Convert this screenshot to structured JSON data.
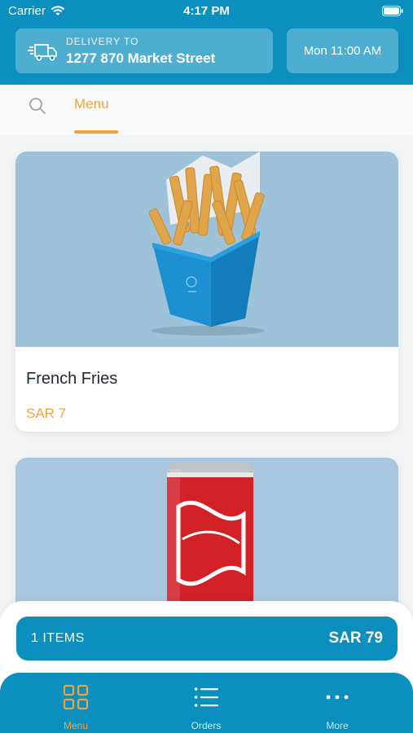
{
  "status_bar": {
    "carrier": "Carrier",
    "time": "4:17 PM"
  },
  "header": {
    "delivery_label": "DELIVERY TO",
    "delivery_address": "1277 870 Market Street",
    "delivery_time": "Mon 11:00 AM"
  },
  "tabs": {
    "active_label": "Menu"
  },
  "menu_items": [
    {
      "name": "French Fries",
      "price": "SAR 7"
    },
    {
      "name": "",
      "price": ""
    }
  ],
  "cart": {
    "items_label": "1 ITEMS",
    "total": "SAR 79"
  },
  "bottom_nav": {
    "items": [
      {
        "label": "Menu",
        "icon": "grid-icon",
        "active": true
      },
      {
        "label": "Orders",
        "icon": "list-icon",
        "active": false
      },
      {
        "label": "More",
        "icon": "more-dots-icon",
        "active": false
      }
    ]
  },
  "colors": {
    "primary": "#0b8fbf",
    "accent": "#f0a33b",
    "text": "#1f2933"
  }
}
